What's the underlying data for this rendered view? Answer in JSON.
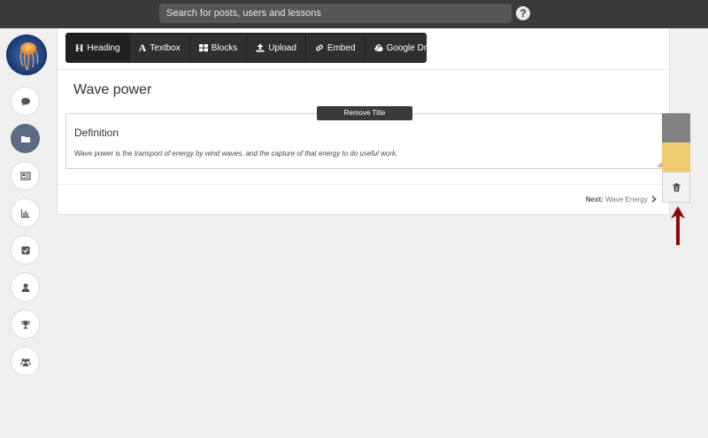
{
  "header": {
    "search_placeholder": "Search for posts, users and lessons",
    "help_label": "?"
  },
  "sidebar": {
    "avatar_icon": "jellyfish-avatar",
    "items": [
      {
        "name": "comment-icon",
        "active": false
      },
      {
        "name": "folder-icon",
        "active": true
      },
      {
        "name": "newspaper-icon",
        "active": false
      },
      {
        "name": "bar-chart-icon",
        "active": false
      },
      {
        "name": "checkbox-icon",
        "active": false
      },
      {
        "name": "user-icon",
        "active": false
      },
      {
        "name": "trophy-icon",
        "active": false
      },
      {
        "name": "group-icon",
        "active": false
      }
    ]
  },
  "toolbar": {
    "heading": "Heading",
    "textbox": "Textbox",
    "blocks": "Blocks",
    "upload": "Upload",
    "embed": "Embed",
    "google_drive": "Google Drive"
  },
  "page": {
    "title": "Wave power",
    "remove_title": "Remove Title",
    "section": {
      "heading": "Definition",
      "text_plain": "Wave power is the ",
      "text_italic": "transport of energy by wind waves, and the capture of that energy to do useful work."
    },
    "next_label": "Next:",
    "next_link": "Wave Energy"
  },
  "colors": {
    "topbar": "#3a3a3a",
    "swatch_gray": "#828282",
    "swatch_yellow": "#f0cb70",
    "arrow": "#8b0a0a",
    "active_nav": "#5d6a86"
  }
}
